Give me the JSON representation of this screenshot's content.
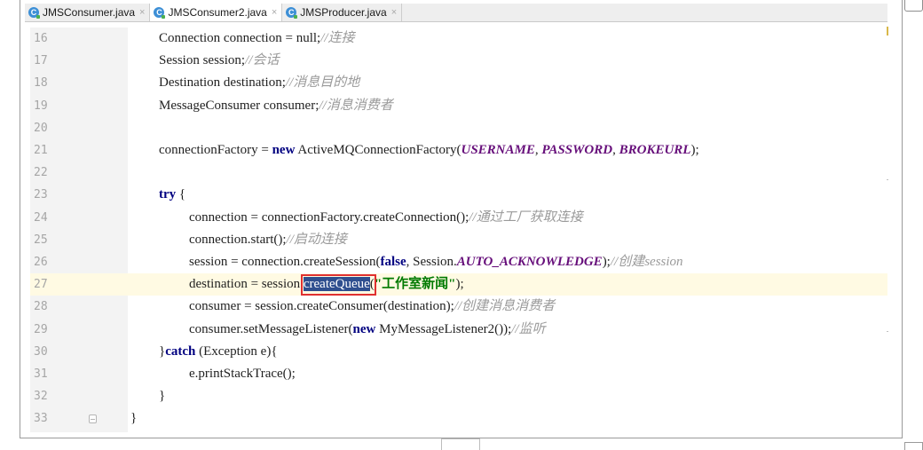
{
  "tabs": [
    {
      "label": "JMSConsumer.java",
      "active": false
    },
    {
      "label": "JMSConsumer2.java",
      "active": true
    },
    {
      "label": "JMSProducer.java",
      "active": false
    }
  ],
  "tab_icon_letter": "C",
  "tab_close_glyph": "×",
  "current_line": "27",
  "lines": [
    {
      "num": "16",
      "indent": 6,
      "tokens": [
        {
          "t": "Connection connection = ",
          "c": ""
        },
        {
          "t": "null",
          "c": "kw-plain"
        },
        {
          "t": ";",
          "c": ""
        },
        {
          "t": "//连接",
          "c": "cm"
        }
      ]
    },
    {
      "num": "17",
      "indent": 6,
      "tokens": [
        {
          "t": "Session session;",
          "c": ""
        },
        {
          "t": "//会话",
          "c": "cm"
        }
      ]
    },
    {
      "num": "18",
      "indent": 6,
      "tokens": [
        {
          "t": "Destination destination;",
          "c": ""
        },
        {
          "t": "//消息目的地",
          "c": "cm"
        }
      ]
    },
    {
      "num": "19",
      "indent": 6,
      "tokens": [
        {
          "t": "MessageConsumer consumer;",
          "c": ""
        },
        {
          "t": "//消息消费者",
          "c": "cm"
        }
      ]
    },
    {
      "num": "20",
      "indent": 0,
      "tokens": []
    },
    {
      "num": "21",
      "indent": 6,
      "tokens": [
        {
          "t": "connectionFactory = ",
          "c": ""
        },
        {
          "t": "new",
          "c": "kw"
        },
        {
          "t": " ActiveMQConnectionFactory(",
          "c": ""
        },
        {
          "t": "USERNAME",
          "c": "fl"
        },
        {
          "t": ", ",
          "c": ""
        },
        {
          "t": "PASSWORD",
          "c": "fl"
        },
        {
          "t": ", ",
          "c": ""
        },
        {
          "t": "BROKEURL",
          "c": "fl"
        },
        {
          "t": ");",
          "c": ""
        }
      ]
    },
    {
      "num": "22",
      "indent": 0,
      "tokens": []
    },
    {
      "num": "23",
      "indent": 6,
      "tokens": [
        {
          "t": "try",
          "c": "kw"
        },
        {
          "t": " {",
          "c": ""
        }
      ]
    },
    {
      "num": "24",
      "indent": 7,
      "tokens": [
        {
          "t": "connection = connectionFactory.createConnection();",
          "c": ""
        },
        {
          "t": "//通过工厂获取连接",
          "c": "cm"
        }
      ]
    },
    {
      "num": "25",
      "indent": 7,
      "tokens": [
        {
          "t": "connection.start();",
          "c": ""
        },
        {
          "t": "//启动连接",
          "c": "cm"
        }
      ]
    },
    {
      "num": "26",
      "indent": 7,
      "tokens": [
        {
          "t": "session = connection.createSession(",
          "c": ""
        },
        {
          "t": "false",
          "c": "kw"
        },
        {
          "t": ", Session.",
          "c": ""
        },
        {
          "t": "AUTO_ACKNOWLEDGE",
          "c": "fl"
        },
        {
          "t": ");",
          "c": ""
        },
        {
          "t": "//创建session",
          "c": "cm"
        }
      ]
    },
    {
      "num": "27",
      "indent": 7,
      "tokens": [
        {
          "t": "destination = session.",
          "c": ""
        },
        {
          "t": "createQueue",
          "c": "hl"
        },
        {
          "t": "(",
          "c": ""
        },
        {
          "t": "\"工作室新闻\"",
          "c": "st"
        },
        {
          "t": ");",
          "c": ""
        }
      ]
    },
    {
      "num": "28",
      "indent": 7,
      "tokens": [
        {
          "t": "consumer = session.createConsumer(destination);",
          "c": ""
        },
        {
          "t": "//创建消息消费者",
          "c": "cm"
        }
      ]
    },
    {
      "num": "29",
      "indent": 7,
      "tokens": [
        {
          "t": "consumer.setMessageListener(",
          "c": ""
        },
        {
          "t": "new",
          "c": "kw"
        },
        {
          "t": " MyMessageListener2());",
          "c": ""
        },
        {
          "t": "//监听",
          "c": "cm"
        }
      ]
    },
    {
      "num": "30",
      "indent": 6,
      "tokens": [
        {
          "t": "}",
          "c": ""
        },
        {
          "t": "catch",
          "c": "kw"
        },
        {
          "t": " (Exception e){",
          "c": ""
        }
      ]
    },
    {
      "num": "31",
      "indent": 7,
      "tokens": [
        {
          "t": "e.printStackTrace();",
          "c": ""
        }
      ]
    },
    {
      "num": "32",
      "indent": 6,
      "tokens": [
        {
          "t": "}",
          "c": ""
        }
      ]
    },
    {
      "num": "33",
      "indent": 4,
      "tokens": [
        {
          "t": "}",
          "c": ""
        }
      ]
    }
  ],
  "colors": {
    "keyword": "#000080",
    "comment": "#9a9a9a",
    "string": "#007a00",
    "field": "#660e7a",
    "selection": "#2f4f8f",
    "current_line": "#fffae3",
    "annotation_box": "#e03030"
  }
}
